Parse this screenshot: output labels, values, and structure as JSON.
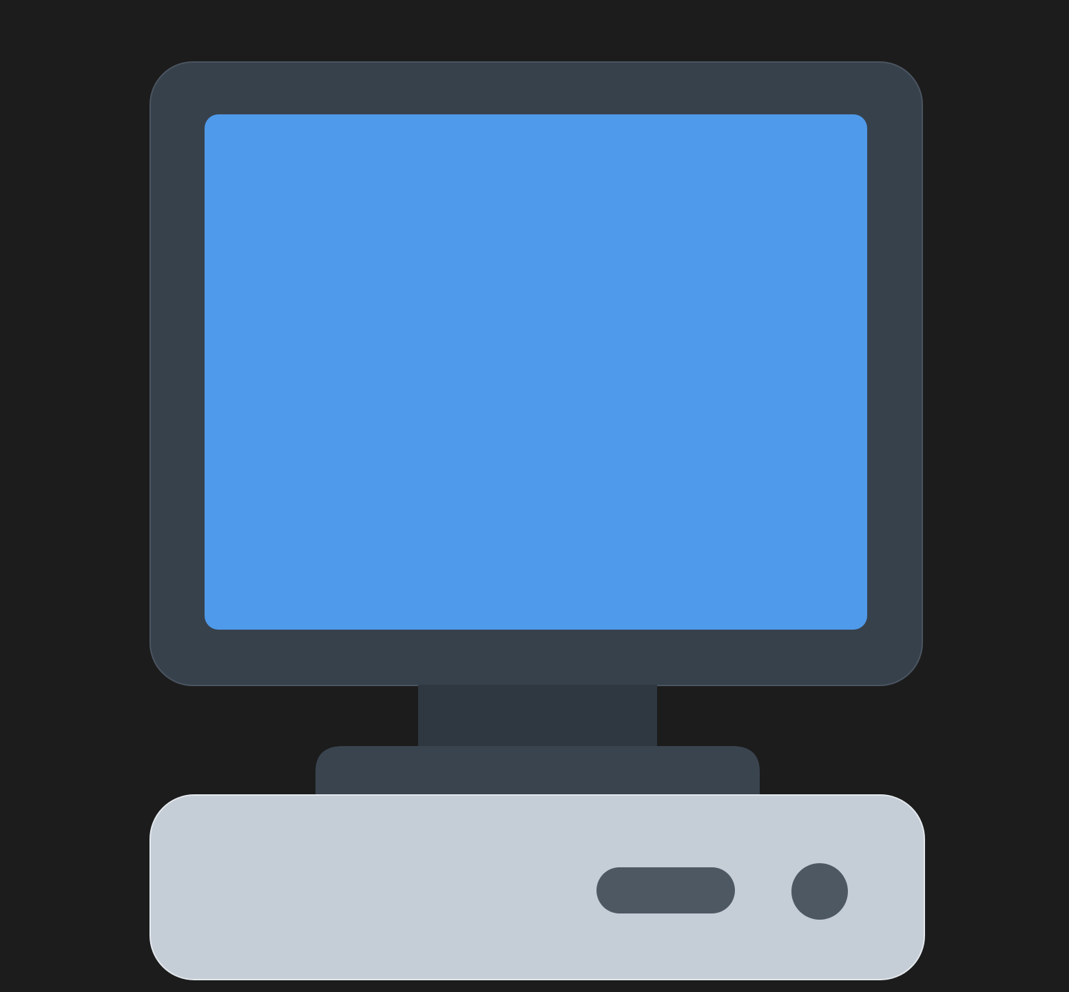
{
  "illustration": {
    "subject": "desktop-computer-icon",
    "colors": {
      "background": "#1c1c1c",
      "monitor_frame": "#37414c",
      "monitor_frame_edge": "#4b5561",
      "screen": "#4f9aea",
      "stand_neck": "#2f3841",
      "stand_base": "#3a444f",
      "computer_base": "#c5cdd6",
      "computer_base_edge": "#e4e9ee",
      "drive_slot": "#4d5863",
      "power_button": "#4d5863"
    }
  }
}
